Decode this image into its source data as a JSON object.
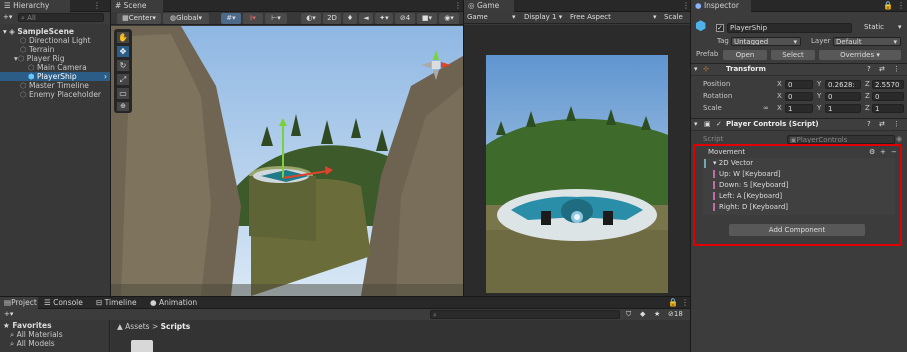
{
  "hierarchy": {
    "tab_label": "Hierarchy",
    "add_label": "+",
    "search_placeholder": "All",
    "scene_name": "SampleScene",
    "items": [
      "Directional Light",
      "Terrain",
      "Player Rig",
      "Main Camera",
      "PlayerShip",
      "Master Timeline",
      "Enemy Placeholder"
    ]
  },
  "scene": {
    "tab_label": "Scene",
    "pivot_label": "Center",
    "space_label": "Global",
    "mode_2d_label": "2D",
    "tools": [
      "view",
      "move",
      "rotate",
      "scale",
      "rect",
      "transform"
    ]
  },
  "game": {
    "tab_label": "Game",
    "view_label": "Game",
    "display_label": "Display 1",
    "aspect_label": "Free Aspect",
    "scale_label": "Scale"
  },
  "inspector": {
    "tab_label": "Inspector",
    "object_name": "PlayerShip",
    "static_label": "Static",
    "tag_label": "Tag",
    "tag_value": "Untagged",
    "layer_label": "Layer",
    "layer_value": "Default",
    "prefab_label": "Prefab",
    "prefab_buttons": [
      "Open",
      "Select",
      "Overrides"
    ],
    "transform": {
      "title": "Transform",
      "rows": [
        {
          "label": "Position",
          "x": "0",
          "y": "0.2628:",
          "z": "2.5570"
        },
        {
          "label": "Rotation",
          "x": "0",
          "y": "0",
          "z": "0"
        },
        {
          "label": "Scale",
          "x": "1",
          "y": "1",
          "z": "1"
        }
      ]
    },
    "player_controls": {
      "title": "Player Controls (Script)",
      "script_label": "Script",
      "script_value": "PlayerControls",
      "movement_label": "Movement",
      "composite_label": "2D Vector",
      "bindings": [
        "Up: W [Keyboard]",
        "Down: S [Keyboard]",
        "Left: A [Keyboard]",
        "Right: D [Keyboard]"
      ]
    },
    "add_component_label": "Add Component",
    "highlight_color": "#e00000"
  },
  "bottom": {
    "tabs": [
      "Project",
      "Console",
      "Timeline",
      "Animation"
    ],
    "add_label": "+",
    "favorites_label": "Favorites",
    "favorites": [
      "All Materials",
      "All Models"
    ],
    "breadcrumb_root": "Assets",
    "breadcrumb_sep": ">",
    "breadcrumb_leaf": "Scripts",
    "count_label": "18"
  },
  "colors": {
    "selection": "#2c5d87",
    "panel": "#383838",
    "toolbar_active": "#4d6a8a"
  }
}
